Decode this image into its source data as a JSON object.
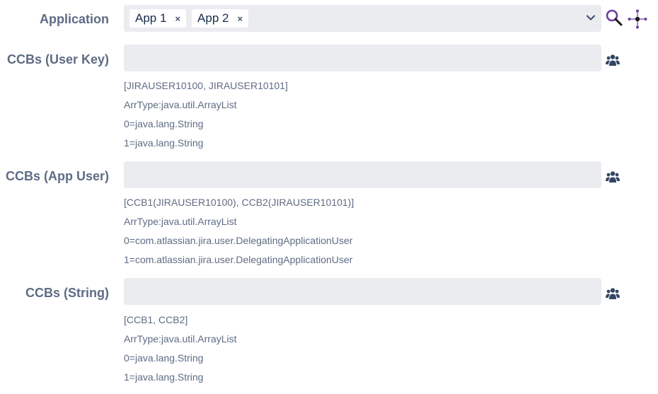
{
  "application": {
    "label": "Application",
    "chips": [
      {
        "label": "App 1",
        "remove": "×"
      },
      {
        "label": "App 2",
        "remove": "×"
      }
    ]
  },
  "ccbs_user_key": {
    "label": "CCBs (User Key)",
    "value": "",
    "info": [
      "[JIRAUSER10100, JIRAUSER10101]",
      "ArrType:java.util.ArrayList",
      "0=java.lang.String",
      "1=java.lang.String"
    ]
  },
  "ccbs_app_user": {
    "label": "CCBs (App User)",
    "value": "",
    "info": [
      "[CCB1(JIRAUSER10100), CCB2(JIRAUSER10101)]",
      "ArrType:java.util.ArrayList",
      "0=com.atlassian.jira.user.DelegatingApplicationUser",
      "1=com.atlassian.jira.user.DelegatingApplicationUser"
    ]
  },
  "ccbs_string": {
    "label": "CCBs (String)",
    "value": "",
    "info": [
      "[CCB1, CCB2]",
      "ArrType:java.util.ArrayList",
      "0=java.lang.String",
      "1=java.lang.String"
    ]
  },
  "icons": {
    "dropdown": "chevron-down-icon",
    "search": "search-icon",
    "graph": "graph-icon",
    "user_picker": "users-icon"
  },
  "colors": {
    "label": "#5e6c84",
    "field_bg": "#ebecf0",
    "search_icon": "#6b3fa0",
    "users_icon": "#344563"
  }
}
